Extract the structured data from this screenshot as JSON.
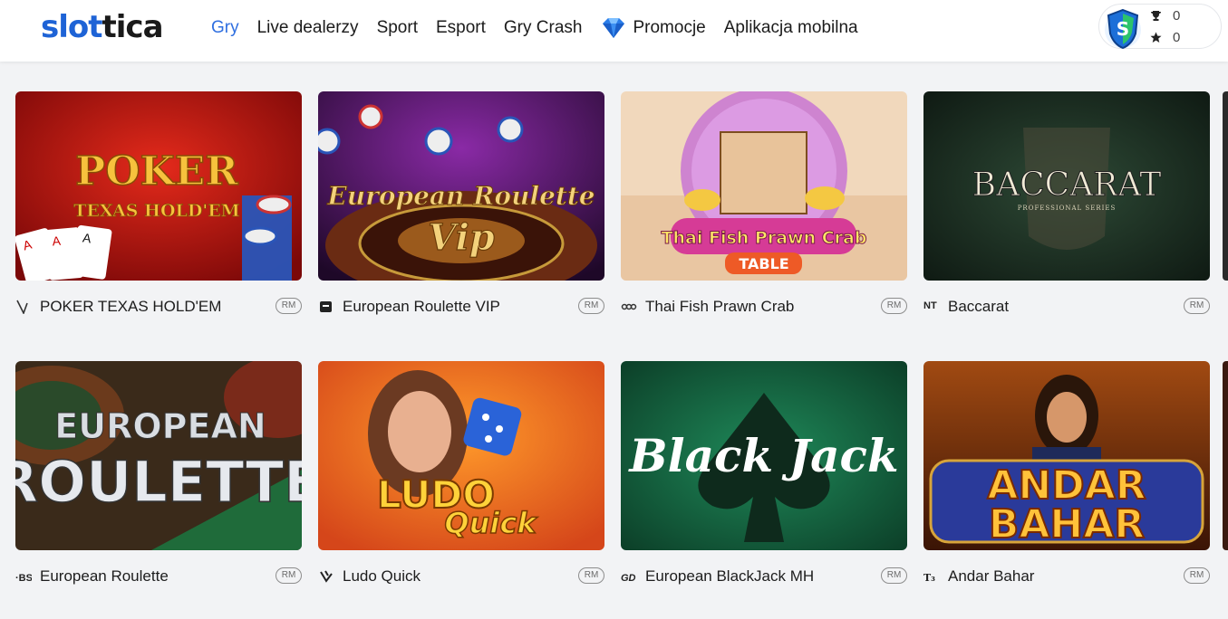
{
  "header": {
    "logo_prefix": "slot",
    "logo_suffix": "tica",
    "nav": [
      {
        "label": "Gry",
        "active": true
      },
      {
        "label": "Live dealerzy"
      },
      {
        "label": "Sport"
      },
      {
        "label": "Esport"
      },
      {
        "label": "Gry Crash"
      },
      {
        "label": "Promocje",
        "icon": "diamond-icon"
      },
      {
        "label": "Aplikacja mobilna"
      }
    ],
    "user": {
      "trophies": "0",
      "stars": "0"
    }
  },
  "games": [
    {
      "title": "POKER TEXAS HOLD'EM",
      "badge": "RM",
      "art_line1": "POKER",
      "art_line2": "TEXAS HOLD'EM"
    },
    {
      "title": "European Roulette VIP",
      "badge": "RM",
      "art_line1": "European Roulette",
      "art_line2": "Vip"
    },
    {
      "title": "Thai Fish Prawn Crab",
      "badge": "RM",
      "art_line1": "Thai Fish Prawn Crab",
      "art_line2": "TABLE"
    },
    {
      "title": "Baccarat",
      "badge": "RM",
      "provider_text": "NT",
      "art_line1": "BACCARAT",
      "art_line2": "PROFESSIONAL SERIES"
    },
    {
      "title": "European Roulette",
      "badge": "RM",
      "art_line1": "EUROPEAN",
      "art_line2": "ROULETTE"
    },
    {
      "title": "Ludo Quick",
      "badge": "RM",
      "art_line1": "LUDO",
      "art_line2": "Quick"
    },
    {
      "title": "European BlackJack MH",
      "badge": "RM",
      "art_line1": "Black Jack",
      "art_line2": ""
    },
    {
      "title": "Andar Bahar",
      "badge": "RM",
      "art_line1": "ANDAR",
      "art_line2": "BAHAR"
    }
  ],
  "colors": {
    "accent": "#2f6fe0",
    "logo_blue": "#1e63d6"
  }
}
